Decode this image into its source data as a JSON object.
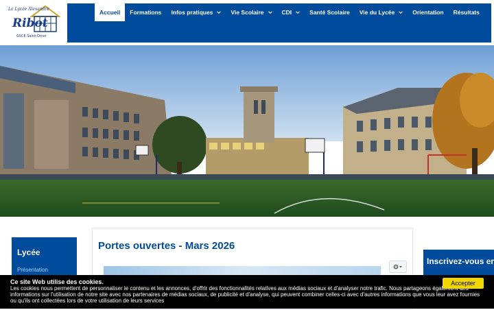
{
  "logo": {
    "line1": "Le Lycée Alexandre",
    "name": "Ribot",
    "line3": "GSCE Saint-Omer"
  },
  "nav": {
    "items": [
      {
        "label": "Accueil",
        "active": true,
        "dropdown": false
      },
      {
        "label": "Formations",
        "active": false,
        "dropdown": false
      },
      {
        "label": "Infos pratiques",
        "active": false,
        "dropdown": true
      },
      {
        "label": "Vie Scolaire",
        "active": false,
        "dropdown": true
      },
      {
        "label": "CDI",
        "active": false,
        "dropdown": true
      },
      {
        "label": "Santé Scolaire",
        "active": false,
        "dropdown": false
      },
      {
        "label": "Vie du Lycée",
        "active": false,
        "dropdown": true
      },
      {
        "label": "Orientation",
        "active": false,
        "dropdown": false
      },
      {
        "label": "Résultats",
        "active": false,
        "dropdown": false
      }
    ]
  },
  "sidebar": {
    "title": "Lycée",
    "link": "Présentation"
  },
  "article": {
    "title": "Portes ouvertes - Mars 2026",
    "tools_icon": "gear-icon"
  },
  "right_box": {
    "title": "Inscrivez-vous en"
  },
  "cookie": {
    "title": "Ce site Web utilise des cookies.",
    "body": "Les cookies nous permettent de personnaliser le contenu et les annonces, d'offrir des fonctionnalités relatives aux médias sociaux et d'analyser notre trafic. Nous partageons également des informations sur l'utilisation de notre site avec nos partenaires de médias sociaux, de publicité et d'analyse, qui peuvent combiner celles-ci avec d'autres informations que vous leur avez fournies ou qu'ils ont collectées lors de votre utilisation de leurs services",
    "accept": "Accepter"
  },
  "colors": {
    "primary": "#004b9b",
    "accept": "#f1d600",
    "link": "#9fd0ff"
  }
}
